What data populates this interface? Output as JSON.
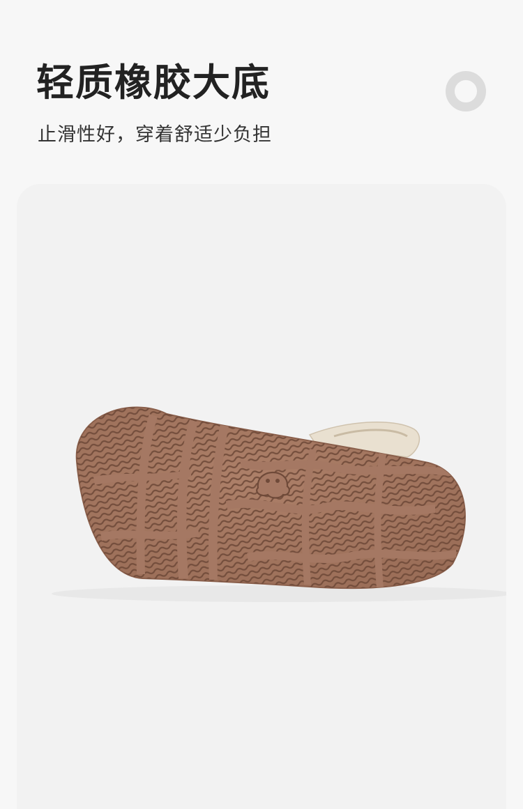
{
  "header": {
    "title": "轻质橡胶大底",
    "subtitle": "止滑性好，穿着舒适少负担"
  },
  "icons": {
    "decoration": "ring-icon"
  },
  "colors": {
    "page_background": "#f7f7f7",
    "card_background": "#f2f2f2",
    "sole": "#a47760",
    "sole_tread": "#7e5644",
    "strap": "#e6dccb",
    "ring": "#dcdcdc",
    "title_text": "#222222"
  }
}
